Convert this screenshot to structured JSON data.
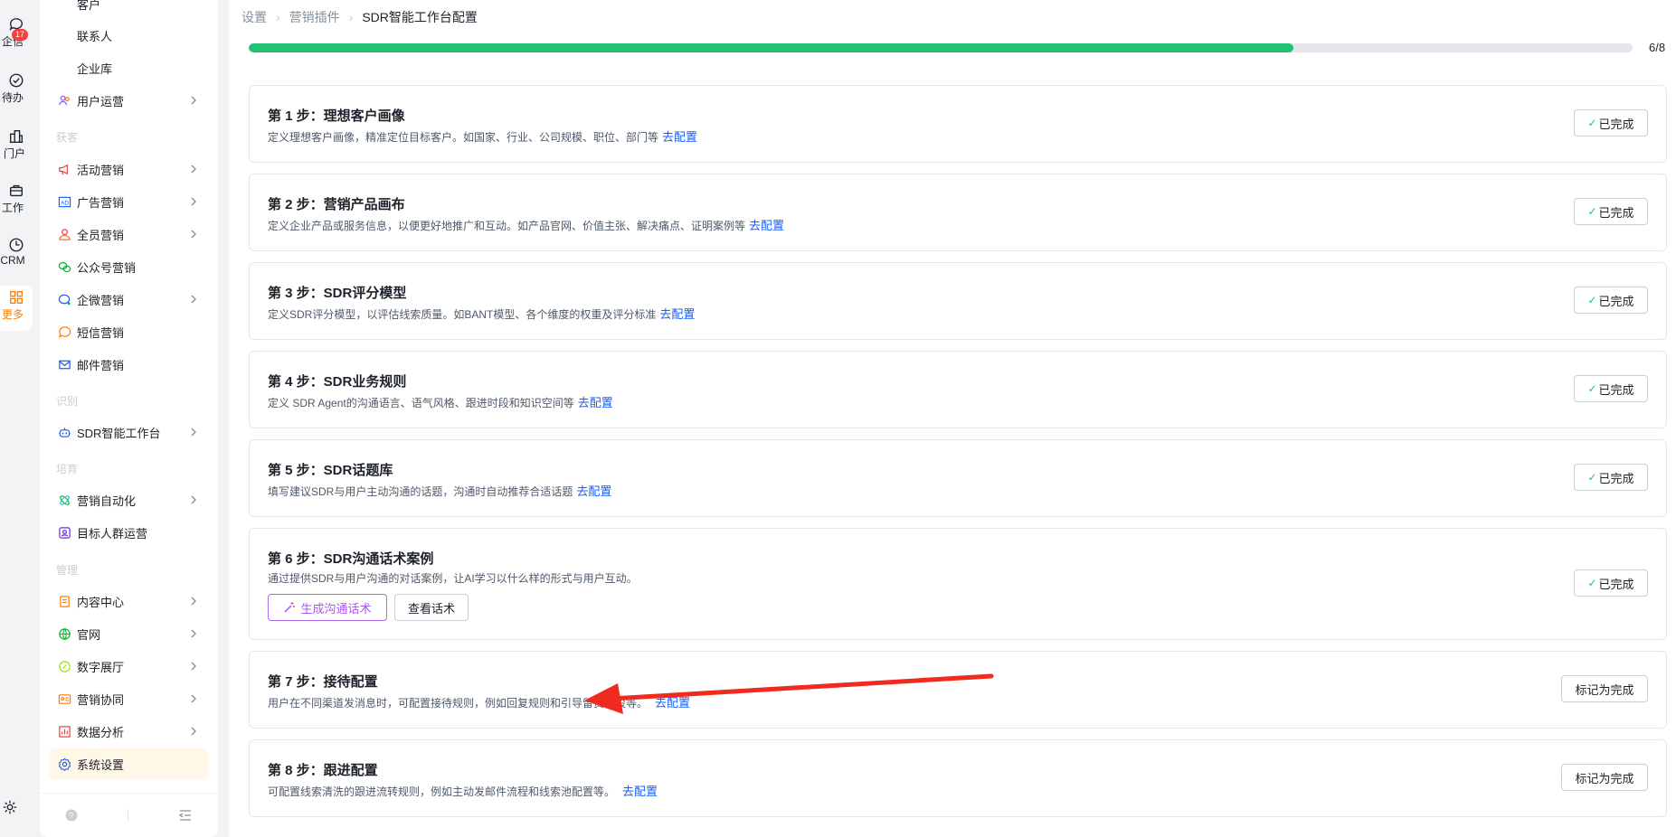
{
  "rail": {
    "items": [
      {
        "label": "企信",
        "badge": "17",
        "icon": "chat-icon"
      },
      {
        "label": "待办",
        "icon": "check-circle-icon"
      },
      {
        "label": "门户",
        "icon": "building-icon"
      },
      {
        "label": "工作",
        "icon": "briefcase-icon"
      },
      {
        "label": "CRM",
        "icon": "clock-icon"
      },
      {
        "label": "更多",
        "icon": "grid-icon"
      }
    ],
    "settings_icon": "gear-icon"
  },
  "sidebar": {
    "top_items": [
      "客户",
      "联系人",
      "企业库"
    ],
    "user_ops": "用户运营",
    "groups": {
      "acquire": "获客",
      "identify": "识别",
      "nurture": "培育",
      "manage": "管理"
    },
    "acquire_items": [
      "活动营销",
      "广告营销",
      "全员营销",
      "公众号营销",
      "企微营销",
      "短信营销",
      "邮件营销"
    ],
    "identify_items": [
      "SDR智能工作台"
    ],
    "nurture_items": [
      "营销自动化",
      "目标人群运营"
    ],
    "manage_items": [
      "内容中心",
      "官网",
      "数字展厅",
      "营销协同",
      "数据分析",
      "系统设置"
    ]
  },
  "breadcrumb": [
    "设置",
    "营销插件",
    "SDR智能工作台配置"
  ],
  "progress": {
    "value": 0.755,
    "text": "6/8"
  },
  "colors": {
    "accent": "#165dff",
    "progress": "#23c273",
    "active": "#ff7d00",
    "arrow": "#f02a1e"
  },
  "steps": [
    {
      "title": "第 1 步：理想客户画像",
      "desc": "定义理想客户画像，精准定位目标客户。如国家、行业、公司规模、职位、部门等",
      "link": "去配置",
      "status": "已完成"
    },
    {
      "title": "第 2 步：营销产品画布",
      "desc": "定义企业产品或服务信息，以便更好地推广和互动。如产品官网、价值主张、解决痛点、证明案例等",
      "link": "去配置",
      "status": "已完成"
    },
    {
      "title": "第 3 步：SDR评分模型",
      "desc": "定义SDR评分模型，以评估线索质量。如BANT模型、各个维度的权重及评分标准",
      "link": "去配置",
      "status": "已完成"
    },
    {
      "title": "第 4 步：SDR业务规则",
      "desc": "定义 SDR Agent的沟通语言、语气风格、跟进时段和知识空间等",
      "link": "去配置",
      "status": "已完成"
    },
    {
      "title": "第 5 步：SDR话题库",
      "desc": "填写建议SDR与用户主动沟通的话题，沟通时自动推荐合适话题",
      "link": "去配置",
      "status": "已完成"
    },
    {
      "title": "第 6 步：SDR沟通话术案例",
      "desc": "通过提供SDR与用户沟通的对话案例，让AI学习以什么样的形式与用户互动。",
      "gen_button": "生成沟通话术",
      "view_button": "查看话术",
      "status": "已完成"
    },
    {
      "title": "第 7 步：接待配置",
      "desc": "用户在不同渠道发消息时，可配置接待规则，例如回复规则和引导留资字段等。",
      "link": "去配置",
      "action": "标记为完成"
    },
    {
      "title": "第 8 步：跟进配置",
      "desc": "可配置线索清洗的跟进流转规则，例如主动发邮件流程和线索池配置等。",
      "link": "去配置",
      "action": "标记为完成"
    }
  ]
}
